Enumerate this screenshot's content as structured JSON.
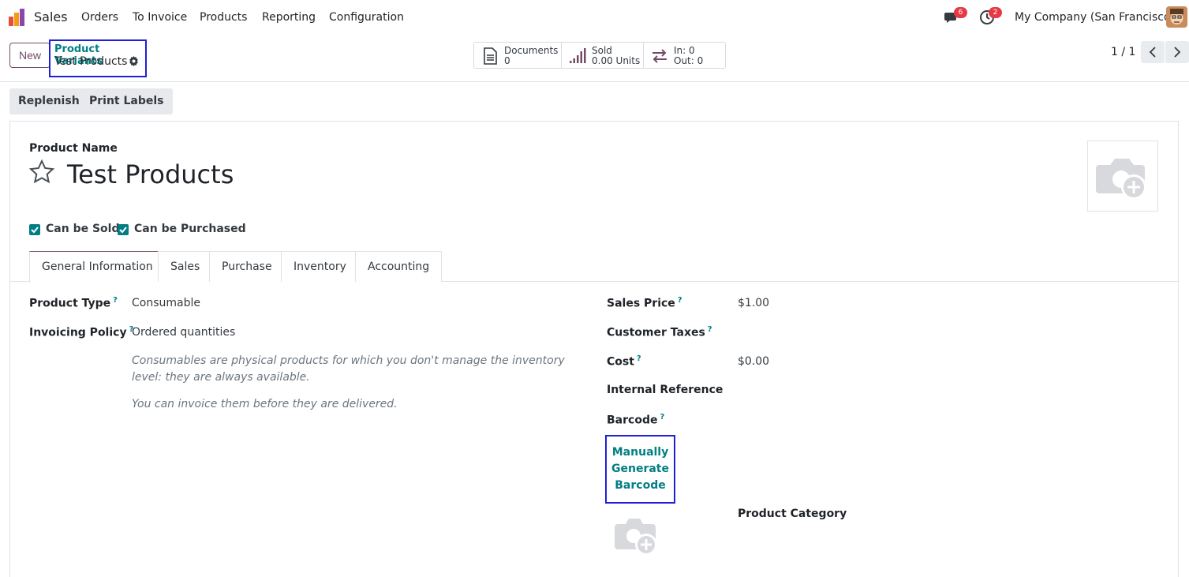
{
  "navbar": {
    "app_name": "Sales",
    "menu": [
      "Orders",
      "To Invoice",
      "Products",
      "Reporting",
      "Configuration"
    ],
    "messages_count": "6",
    "activities_count": "2",
    "company": "My Company (San Francisco)"
  },
  "control": {
    "new_label": "New",
    "breadcrumb_parent": "Product Variants",
    "breadcrumb_current": "Test Products",
    "smart_buttons": {
      "documents_label": "Documents",
      "documents_value": "0",
      "sold_label": "Sold",
      "sold_value": "0.00 Units",
      "in_label": "In: 0",
      "out_label": "Out: 0"
    },
    "pager": "1 / 1"
  },
  "actions": {
    "replenish": "Replenish",
    "print_labels": "Print Labels"
  },
  "form": {
    "name_label": "Product Name",
    "product_name": "Test Products",
    "can_be_sold": "Can be Sold",
    "can_be_purchased": "Can be Purchased",
    "tabs": [
      "General Information",
      "Sales",
      "Purchase",
      "Inventory",
      "Accounting"
    ],
    "product_type_label": "Product Type",
    "product_type_value": "Consumable",
    "invoicing_policy_label": "Invoicing Policy",
    "invoicing_policy_value": "Ordered quantities",
    "help_consumable": "Consumables are physical products for which you don't manage the inventory level: they are always available.",
    "help_invoice": "You can invoice them before they are delivered.",
    "sales_price_label": "Sales Price",
    "sales_price_value": "$1.00",
    "customer_taxes_label": "Customer Taxes",
    "cost_label": "Cost",
    "cost_value": "$0.00",
    "internal_reference_label": "Internal Reference",
    "barcode_label": "Barcode",
    "generate_barcode": "Manually Generate Barcode",
    "product_category_label": "Product Category",
    "help_marker": "?"
  },
  "colors": {
    "accent": "#714b67",
    "link": "#017e84",
    "highlight": "#1f1fd6",
    "badge": "#e63946"
  }
}
